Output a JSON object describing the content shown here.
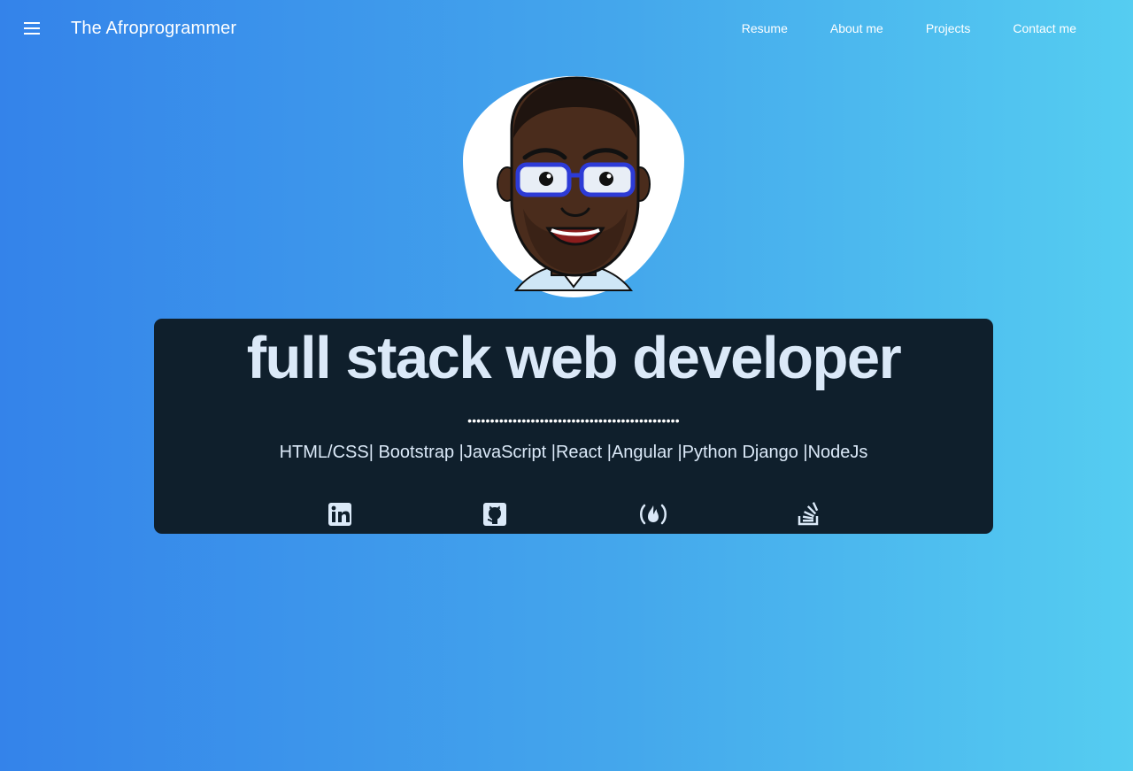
{
  "header": {
    "brand": "The Afroprogrammer",
    "nav": [
      {
        "label": "Resume"
      },
      {
        "label": "About me"
      },
      {
        "label": "Projects"
      },
      {
        "label": "Contact me"
      }
    ]
  },
  "hero": {
    "title": "full stack web developer",
    "separator": "•••••••••••••••••••••••••••••••••••••••••••••••",
    "skills": "HTML/CSS| Bootstrap |JavaScript |React |Angular |Python Django |NodeJs"
  },
  "social": [
    {
      "icon": "linkedin-icon"
    },
    {
      "icon": "github-icon"
    },
    {
      "icon": "freecodecamp-icon"
    },
    {
      "icon": "stackoverflow-icon"
    }
  ],
  "colors": {
    "gradient_start": "#3483ea",
    "gradient_end": "#55cdf1",
    "card_bg": "#0f1f2c",
    "title_text": "#dbe9f8"
  }
}
